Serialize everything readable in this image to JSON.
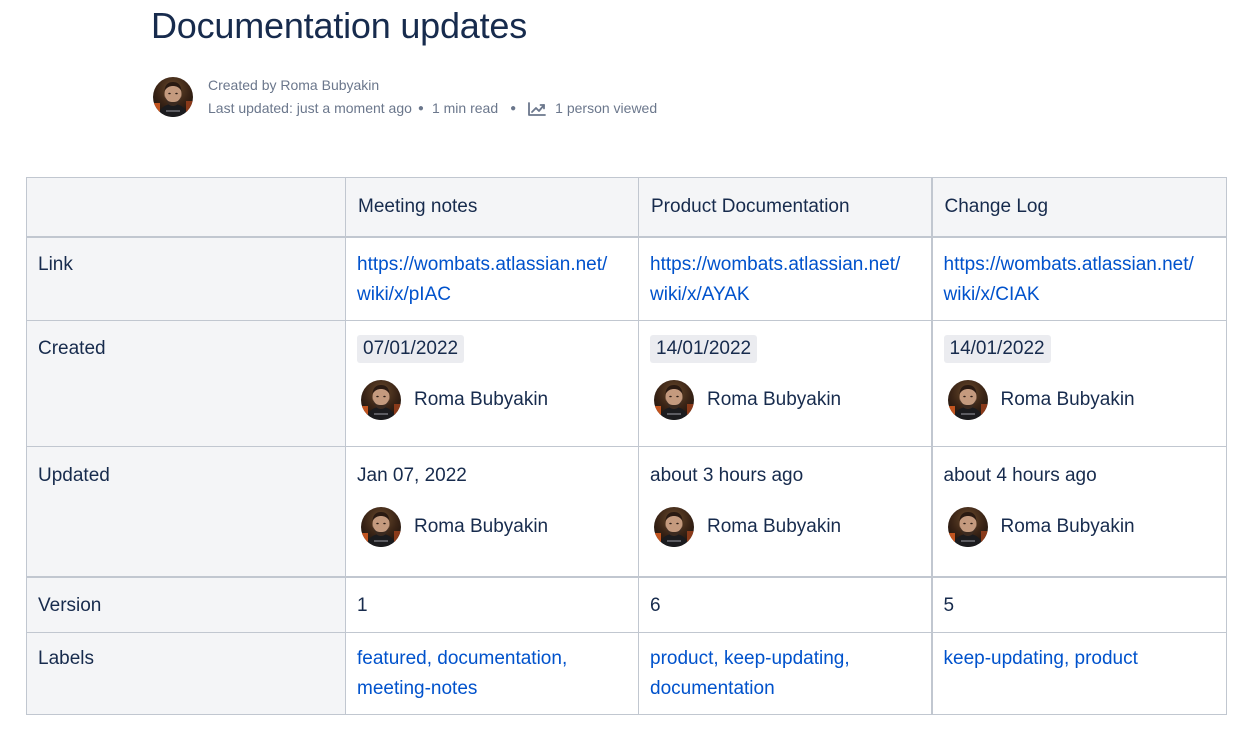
{
  "page": {
    "title": "Documentation updates",
    "created_by": "Created by Roma Bubyakin",
    "last_updated": "Last updated: just a moment ago",
    "read_time": "1 min read",
    "views": "1 person viewed"
  },
  "icons": {
    "views": "trend-up-icon",
    "avatar": "user-avatar-photo"
  },
  "colors": {
    "link": "#0052cc",
    "text": "#172b4d",
    "meta": "#6b778c",
    "header_bg": "#f4f5f7",
    "lozenge_bg": "#ebecf0",
    "border": "#c1c7d0"
  },
  "table": {
    "columns": [
      "Meeting notes",
      "Product Documentation",
      "Change Log"
    ],
    "row_labels": {
      "link": "Link",
      "created": "Created",
      "updated": "Updated",
      "version": "Version",
      "labels": "Labels"
    },
    "cols": [
      {
        "link_line1": "https://wombats.atlassian.net/",
        "link_line2": "wiki/x/pIAC",
        "created_date": "07/01/2022",
        "created_by": "Roma Bubyakin",
        "updated": "Jan 07, 2022",
        "updated_by": "Roma Bubyakin",
        "version": "1",
        "labels": [
          "featured",
          "documentation",
          "meeting-notes"
        ]
      },
      {
        "link_line1": "https://wombats.atlassian.net/",
        "link_line2": "wiki/x/AYAK",
        "created_date": "14/01/2022",
        "created_by": "Roma Bubyakin",
        "updated": "about 3 hours ago",
        "updated_by": "Roma Bubyakin",
        "version": "6",
        "labels": [
          "product",
          "keep-updating",
          "documentation"
        ]
      },
      {
        "link_line1": "https://wombats.atlassian.net/",
        "link_line2": "wiki/x/CIAK",
        "created_date": "14/01/2022",
        "created_by": "Roma Bubyakin",
        "updated": "about 4 hours ago",
        "updated_by": "Roma Bubyakin",
        "version": "5",
        "labels": [
          "keep-updating",
          "product"
        ]
      }
    ]
  }
}
